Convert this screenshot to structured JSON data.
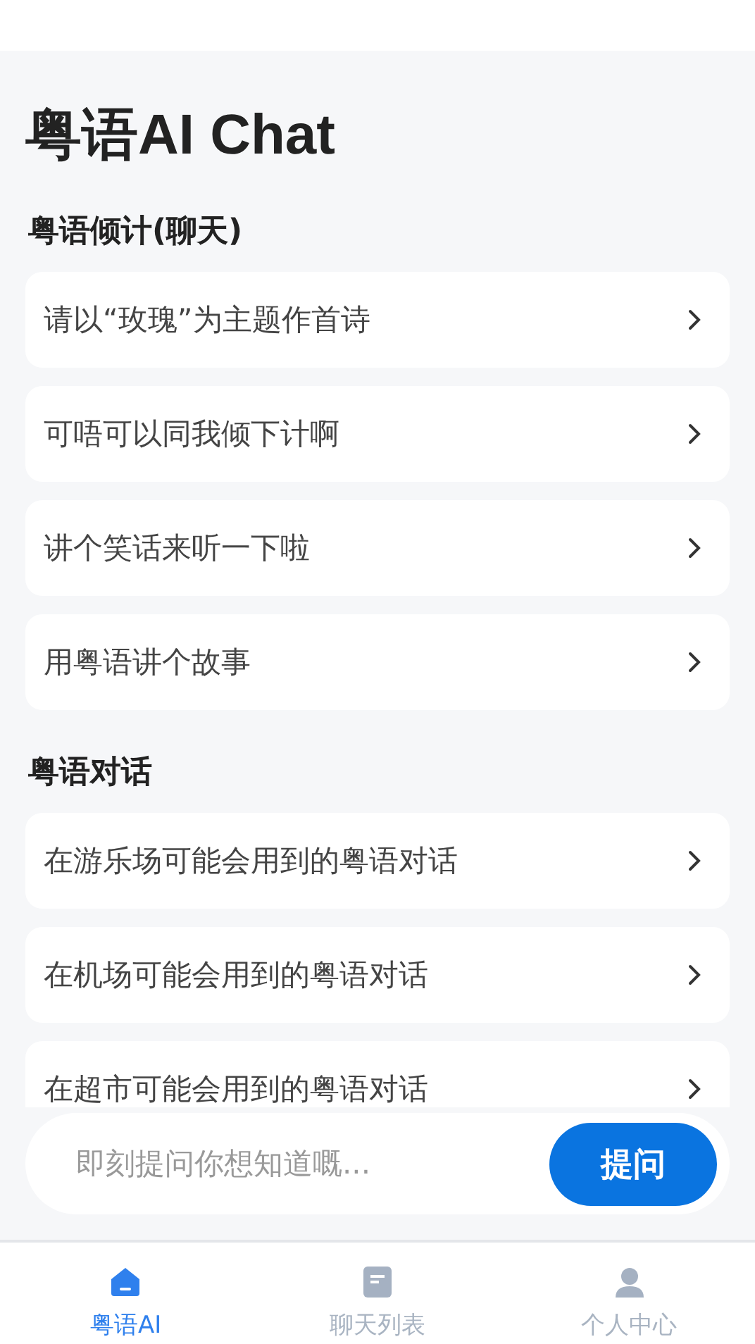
{
  "title": "粤语AI Chat",
  "sections": [
    {
      "heading": "粤语倾计(聊天)",
      "items": [
        "请以“玫瑰”为主题作首诗",
        "可唔可以同我倾下计啊",
        "讲个笑话来听一下啦",
        "用粤语讲个故事"
      ]
    },
    {
      "heading": "粤语对话",
      "items": [
        "在游乐场可能会用到的粤语对话",
        "在机场可能会用到的粤语对话",
        "在超市可能会用到的粤语对话"
      ]
    }
  ],
  "input": {
    "placeholder": "即刻提问你想知道嘅...",
    "button": "提问"
  },
  "tabs": [
    {
      "label": "粤语AI",
      "kind": "home",
      "selected": true
    },
    {
      "label": "聊天列表",
      "kind": "list",
      "selected": false
    },
    {
      "label": "个人中心",
      "kind": "person",
      "selected": false
    }
  ]
}
